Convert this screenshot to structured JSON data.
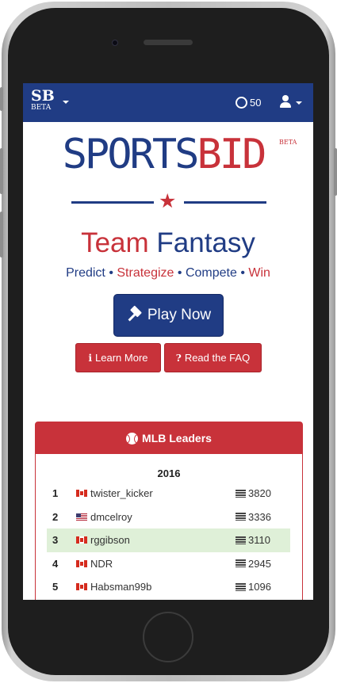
{
  "navbar": {
    "brand_main": "SB",
    "brand_sub": "BETA",
    "coins": "50"
  },
  "logo": {
    "sports": "SPORTS",
    "bid": "BID",
    "beta": "BETA"
  },
  "hero": {
    "title_team": "Team",
    "title_fantasy": "Fantasy",
    "tagline": [
      {
        "text": "Predict",
        "color": "#203c84"
      },
      {
        "text": "Strategize",
        "color": "#c8323a"
      },
      {
        "text": "Compete",
        "color": "#203c84"
      },
      {
        "text": "Win",
        "color": "#c8323a"
      }
    ],
    "separator": "•",
    "play_label": "Play Now",
    "learn_label": "Learn More",
    "faq_label": "Read the FAQ",
    "faq_icon": "?",
    "learn_icon": "i"
  },
  "leaders": {
    "title": "MLB Leaders",
    "year": "2016",
    "rows": [
      {
        "rank": "1",
        "flag": "ca-flag-icon",
        "name": "twister_kicker",
        "score": "3820",
        "highlight": false
      },
      {
        "rank": "2",
        "flag": "us-flag-icon",
        "name": "dmcelroy",
        "score": "3336",
        "highlight": false
      },
      {
        "rank": "3",
        "flag": "ca-flag-icon",
        "name": "rggibson",
        "score": "3110",
        "highlight": true
      },
      {
        "rank": "4",
        "flag": "ca-flag-icon",
        "name": "NDR",
        "score": "2945",
        "highlight": false
      },
      {
        "rank": "5",
        "flag": "ca-flag-icon",
        "name": "Habsman99b",
        "score": "1096",
        "highlight": false
      }
    ]
  },
  "colors": {
    "brand_blue": "#203c84",
    "brand_red": "#c8323a",
    "highlight_green": "#dff0d8"
  }
}
